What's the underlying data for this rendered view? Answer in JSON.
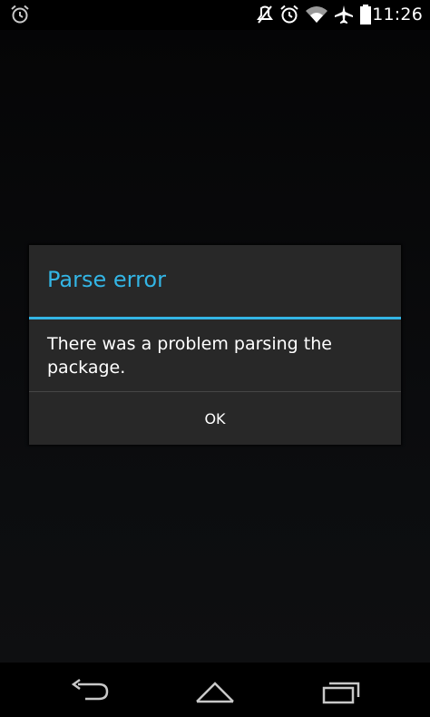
{
  "status_bar": {
    "time": "11:26",
    "icons": [
      "alarm-icon",
      "mute-icon",
      "alarm-icon",
      "wifi-icon",
      "airplane-icon",
      "battery-icon"
    ]
  },
  "dialog": {
    "title": "Parse error",
    "message": "There was a problem parsing the package.",
    "ok_label": "OK"
  },
  "nav_bar": {
    "icons": [
      "back-icon",
      "home-icon",
      "recents-icon"
    ]
  },
  "colors": {
    "accent": "#33b5e5",
    "dialog_bg": "#282828",
    "screen_bg": "#000000"
  }
}
